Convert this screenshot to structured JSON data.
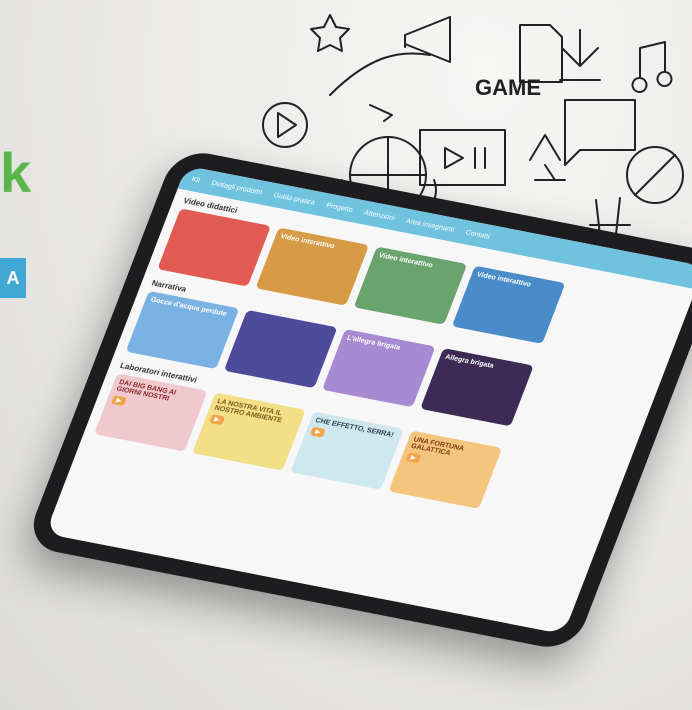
{
  "doodles": {
    "game_label": "GAME"
  },
  "tablet": {
    "nav": {
      "items": [
        "Kit",
        "Dettagli prodotto",
        "Guida pratica",
        "Progetto",
        "Attenzioni",
        "Area insegnanti",
        "Contatti"
      ]
    },
    "sections": [
      {
        "title": "Video didattici",
        "cards": [
          {
            "text": ""
          },
          {
            "text": "Video interattivo"
          },
          {
            "text": "Video interattivo"
          },
          {
            "text": "Video interattivo"
          }
        ]
      },
      {
        "title": "Narrativa",
        "cards": [
          {
            "text": "Gocce d'acqua perdute"
          },
          {
            "text": ""
          },
          {
            "text": "L'allegra brigata"
          },
          {
            "text": "Allegra brigata"
          }
        ]
      },
      {
        "title": "Laboratori interattivi",
        "cards": [
          {
            "text": "DAI BIG BANG AI GIORNI NOSTRI"
          },
          {
            "text": "LA NOSTRA VITA IL NOSTRO AMBIENTE"
          },
          {
            "text": "CHE EFFETTO, SERRA!"
          },
          {
            "text": "UNA FORTUNA GALATTICA"
          }
        ]
      }
    ]
  }
}
